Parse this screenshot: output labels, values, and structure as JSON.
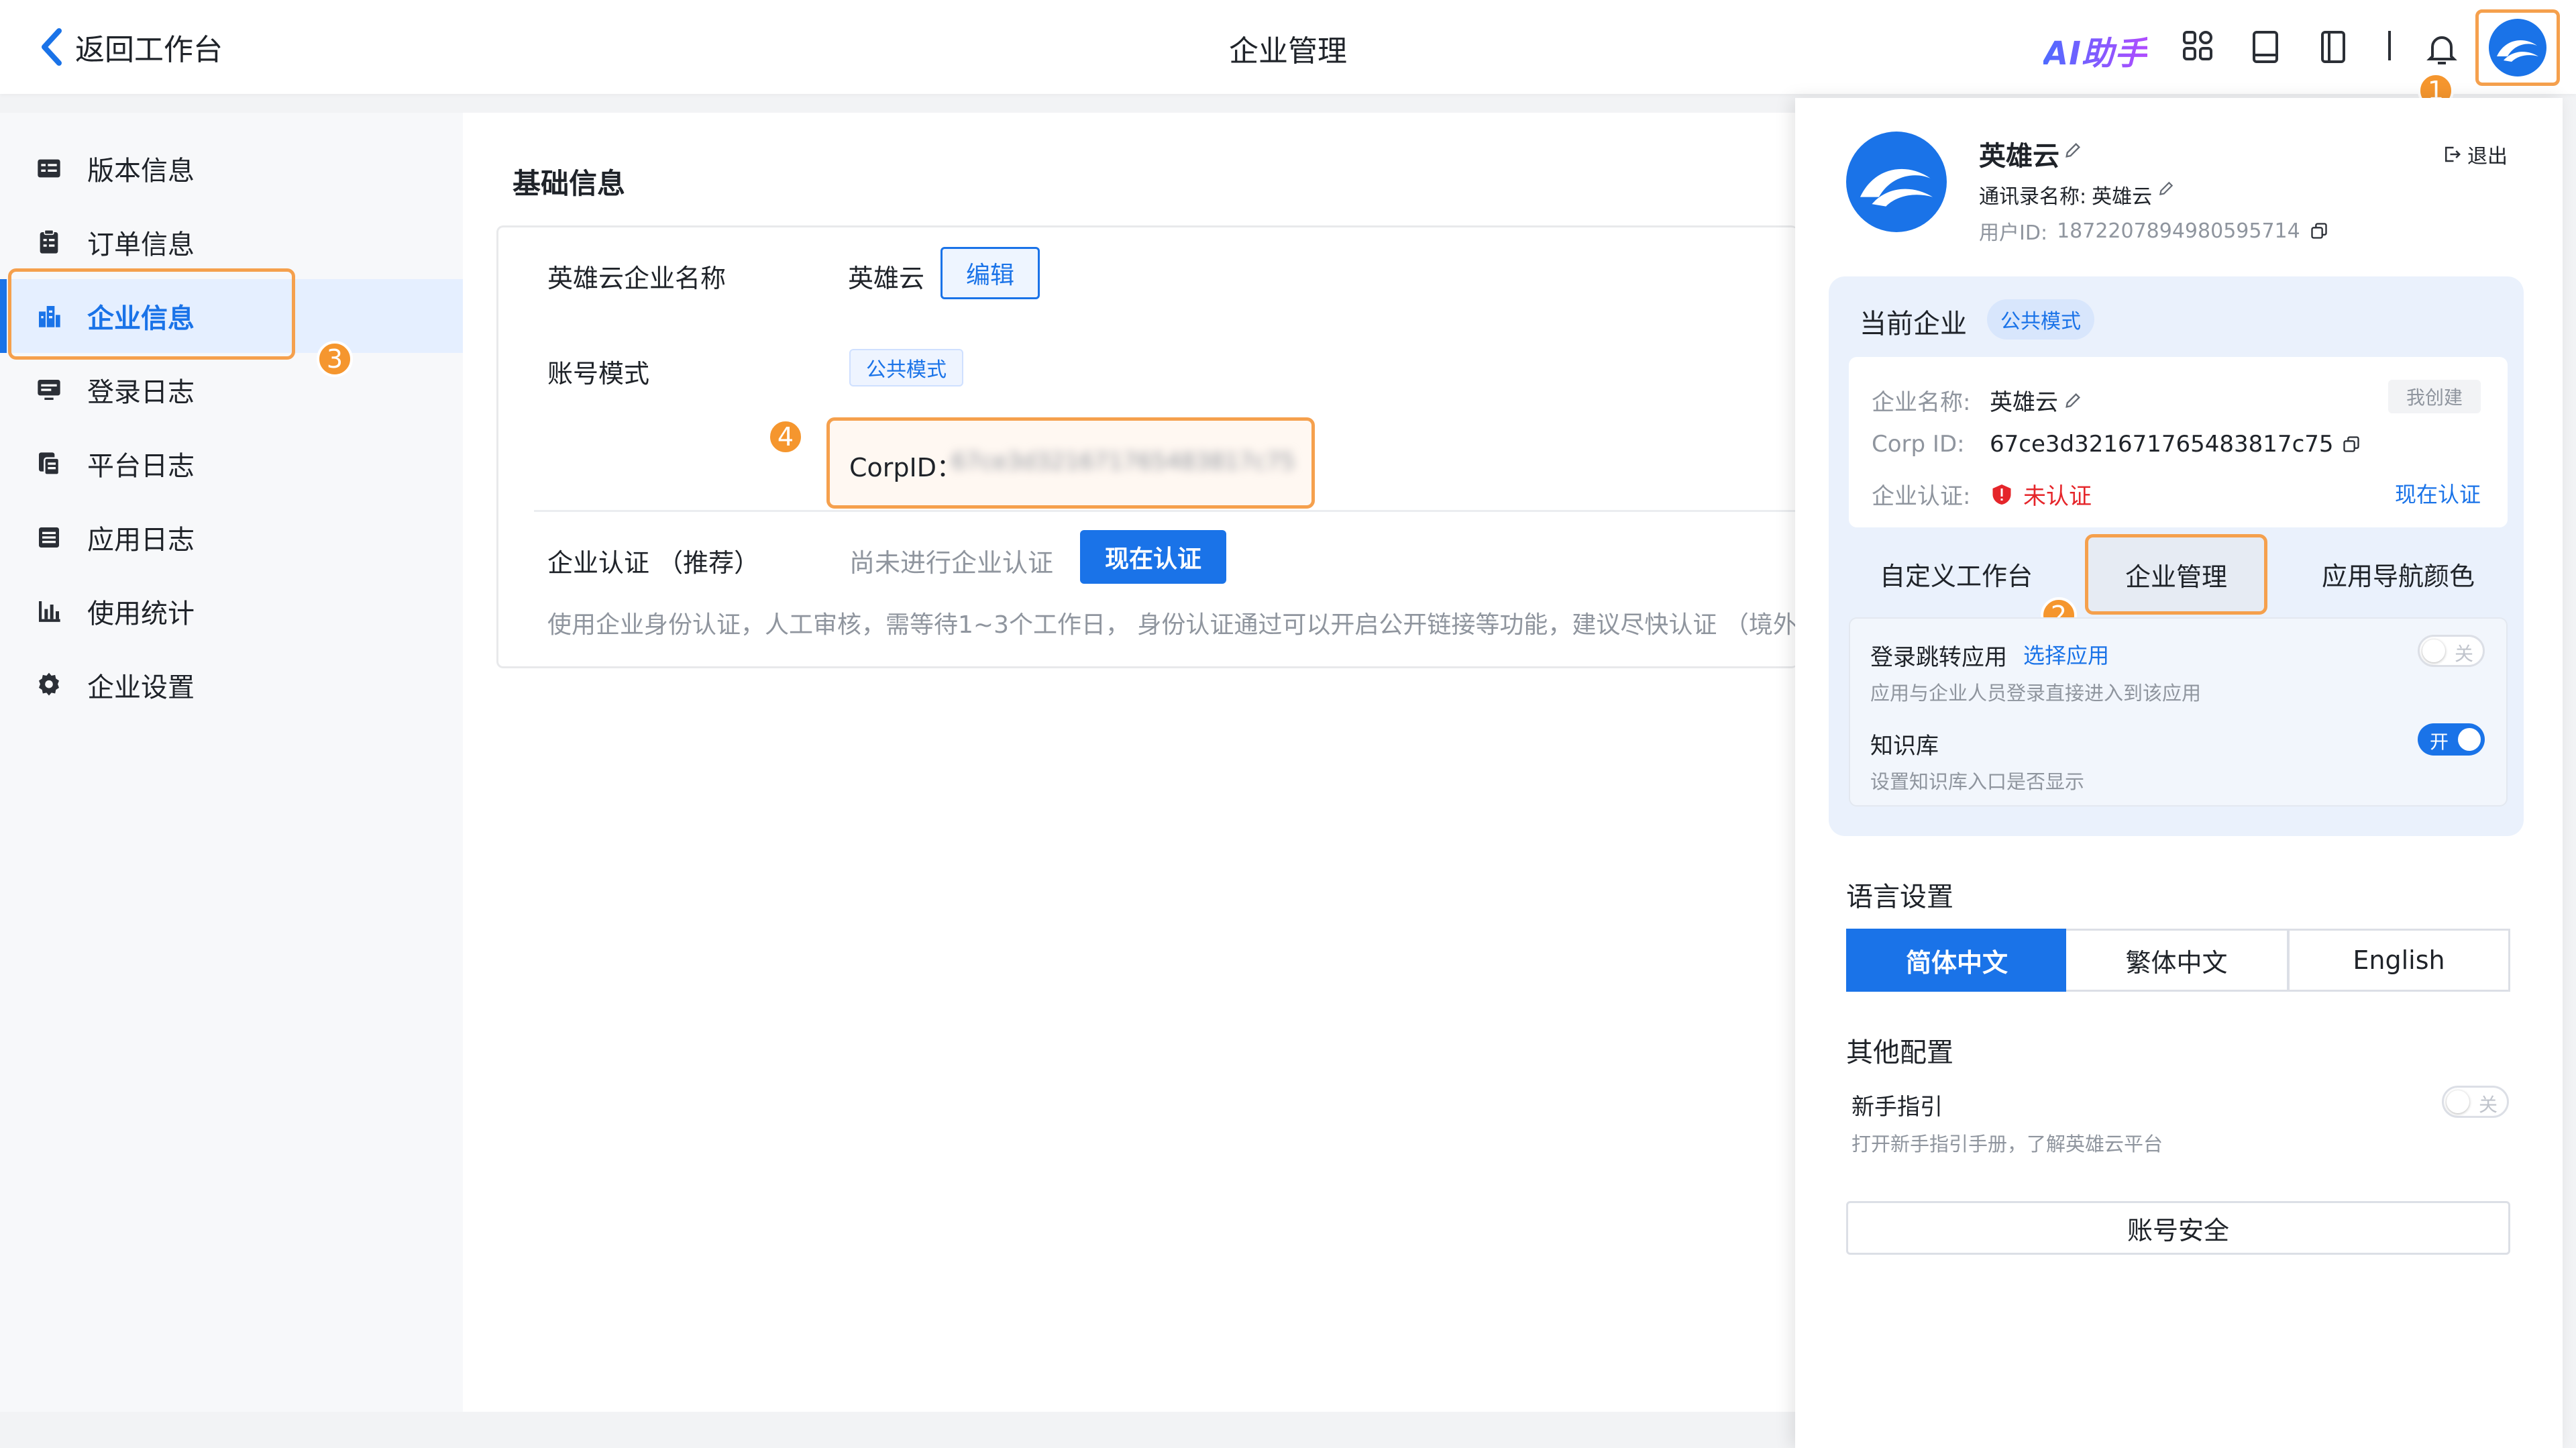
{
  "topbar": {
    "back_label": "返回工作台",
    "title": "企业管理",
    "ai_label": "AI助手"
  },
  "sidebar": {
    "items": [
      {
        "label": "版本信息",
        "icon": "version-icon"
      },
      {
        "label": "订单信息",
        "icon": "order-icon"
      },
      {
        "label": "企业信息",
        "icon": "building-icon",
        "active": true
      },
      {
        "label": "登录日志",
        "icon": "monitor-icon"
      },
      {
        "label": "平台日志",
        "icon": "document-copy-icon"
      },
      {
        "label": "应用日志",
        "icon": "list-icon"
      },
      {
        "label": "使用统计",
        "icon": "bar-chart-icon"
      },
      {
        "label": "企业设置",
        "icon": "gear-icon"
      }
    ]
  },
  "badges": {
    "b1": "1",
    "b2": "2",
    "b3": "3",
    "b4": "4"
  },
  "main": {
    "section_title": "基础信息",
    "company_name_label": "英雄云企业名称",
    "company_name_value": "英雄云",
    "edit_button": "编辑",
    "account_mode_label": "账号模式",
    "account_mode_tag": "公共模式",
    "corpid_label": "CorpID：",
    "corpid_value": "67ce3d321671765483817c75",
    "cert_label": "企业认证 （推荐）",
    "cert_status": "尚未进行企业认证",
    "cert_button": "现在认证",
    "cert_desc": "使用企业身份认证，人工审核，需等待1~3个工作日， 身份认证通过可以开启公开链接等功能，建议尽快认证 （境外企业"
  },
  "panel": {
    "user_name": "英雄云",
    "logout": "退出",
    "contact_name_label": "通讯录名称:",
    "contact_name_value": "英雄云",
    "user_id_label": "用户ID:",
    "user_id_value": "1872207894980595714",
    "current_company_title": "当前企业",
    "current_company_tag": "公共模式",
    "company_name_label": "企业名称:",
    "company_name_value": "英雄云",
    "created_by_me": "我创建",
    "corp_id_label": "Corp ID:",
    "corp_id_value": "67ce3d321671765483817c75",
    "cert_label": "企业认证:",
    "cert_status": "未认证",
    "cert_link": "现在认证",
    "tabs": [
      "自定义工作台",
      "企业管理",
      "应用导航颜色"
    ],
    "login_redirect_label": "登录跳转应用",
    "login_redirect_link": "选择应用",
    "login_redirect_desc": "应用与企业人员登录直接进入到该应用",
    "toggle_off_text": "关",
    "knowledge_label": "知识库",
    "knowledge_desc": "设置知识库入口是否显示",
    "toggle_on_text": "开",
    "language_title": "语言设置",
    "languages": [
      "简体中文",
      "繁体中文",
      "English"
    ],
    "other_title": "其他配置",
    "guide_label": "新手指引",
    "guide_desc": "打开新手指引手册，了解英雄云平台",
    "account_security": "账号安全"
  },
  "colors": {
    "primary": "#1a73e8",
    "highlight": "#f5a04d",
    "danger": "#e5252a"
  }
}
